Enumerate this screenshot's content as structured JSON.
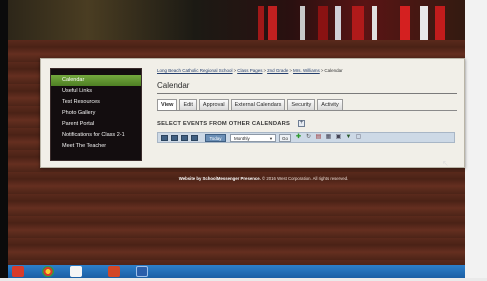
{
  "sidebar": {
    "items": [
      {
        "label": "Calendar"
      },
      {
        "label": "Useful Links"
      },
      {
        "label": "Test Resources"
      },
      {
        "label": "Photo Gallery"
      },
      {
        "label": "Parent Portal"
      },
      {
        "label": "Notifications for Class 2-1"
      },
      {
        "label": "Meet The Teacher"
      }
    ]
  },
  "breadcrumb": {
    "items": [
      {
        "label": "Long Beach Catholic Regional School"
      },
      {
        "label": "Class Pages"
      },
      {
        "label": "2nd Grade"
      },
      {
        "label": "Mrs. Williams"
      }
    ],
    "current": "Calendar",
    "separator": ">"
  },
  "page": {
    "title": "Calendar"
  },
  "tabs": [
    {
      "label": "View"
    },
    {
      "label": "Edit"
    },
    {
      "label": "Approval"
    },
    {
      "label": "External Calendars"
    },
    {
      "label": "Security"
    },
    {
      "label": "Activity"
    }
  ],
  "events": {
    "heading": "SELECT EVENTS FROM OTHER CALENDARS",
    "add_symbol": "+"
  },
  "toolbar": {
    "today_label": "Today",
    "view_select_value": "Monthly",
    "go_label": "Go"
  },
  "footer": {
    "website_by": "Website by SchoolMessenger Presence.",
    "copyright": "© 2016 West Corporation. All rights reserved."
  },
  "colors": {
    "sidebar_bg": "#130d0f",
    "sidebar_active": "#5e9230",
    "toolbar_bg": "#cdd9e6",
    "panel_bg": "#f1efe8",
    "taskbar": "#1f66ae"
  },
  "icons": [
    "first-icon",
    "prev-icon",
    "next-icon",
    "last-icon",
    "add-event-icon",
    "refresh-icon",
    "print-icon",
    "export-icon",
    "settings-icon",
    "filter-icon",
    "help-icon"
  ]
}
